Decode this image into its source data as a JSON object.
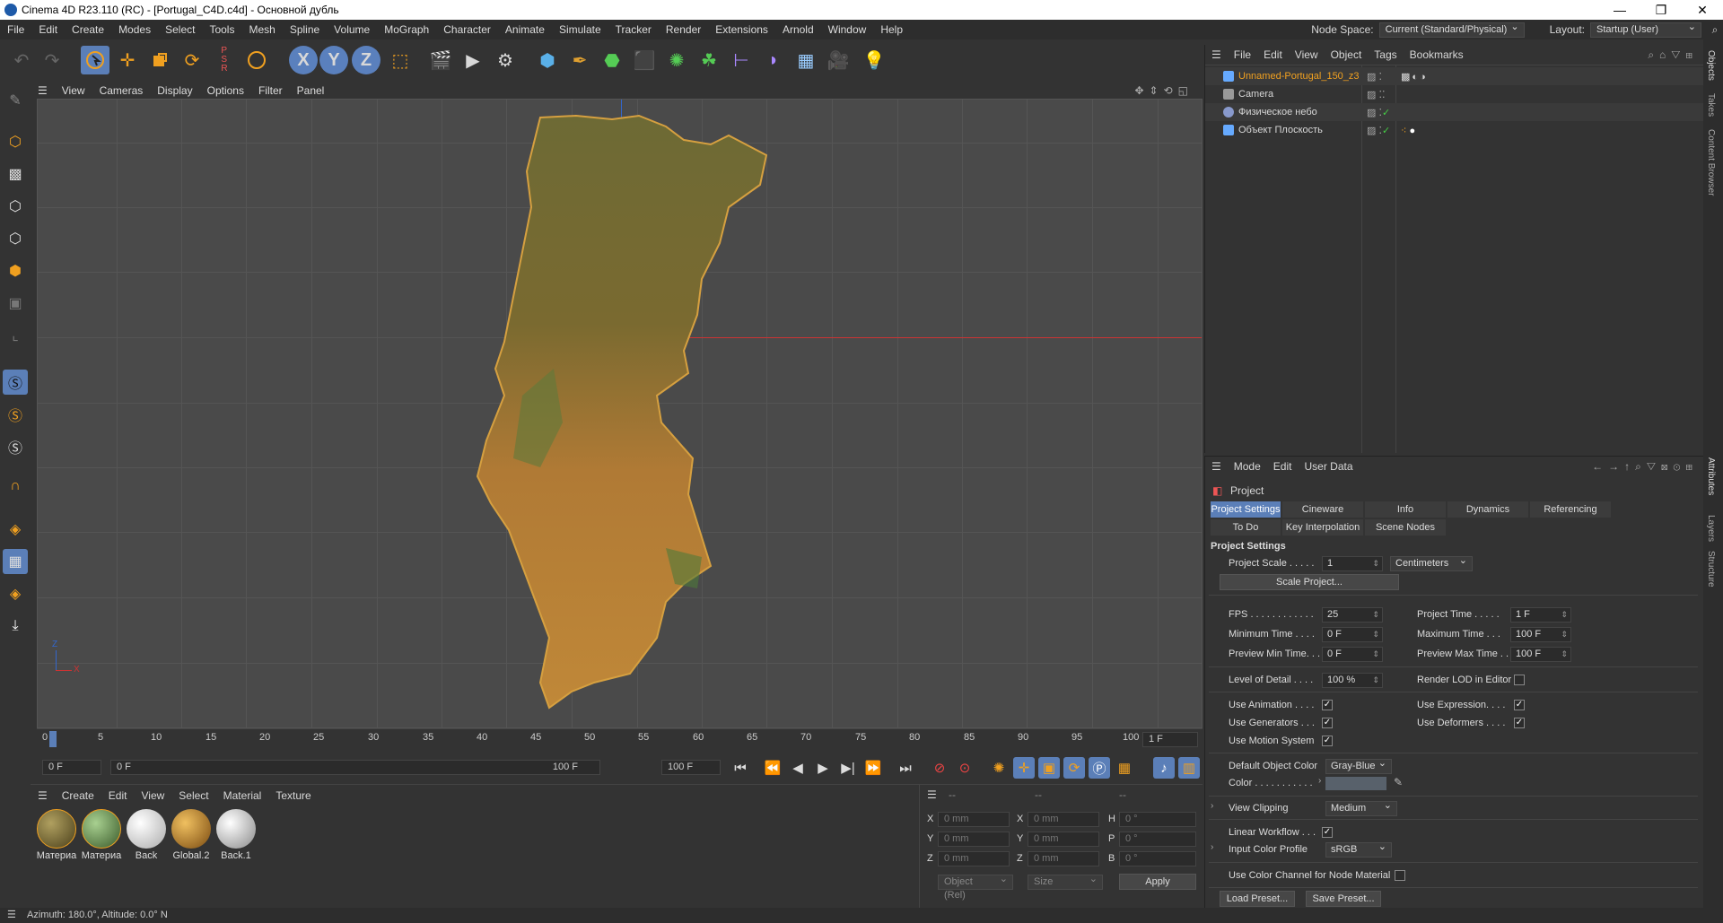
{
  "window": {
    "title": "Cinema 4D R23.110 (RC) - [Portugal_C4D.c4d] - Основной дубль",
    "controls": [
      "—",
      "❐",
      "✕"
    ]
  },
  "menubar": {
    "items": [
      "File",
      "Edit",
      "Create",
      "Modes",
      "Select",
      "Tools",
      "Mesh",
      "Spline",
      "Volume",
      "MoGraph",
      "Character",
      "Animate",
      "Simulate",
      "Tracker",
      "Render",
      "Extensions",
      "Arnold",
      "Window",
      "Help"
    ],
    "node_space_label": "Node Space:",
    "node_space_value": "Current (Standard/Physical)",
    "layout_label": "Layout:",
    "layout_value": "Startup (User)"
  },
  "viewport": {
    "menu": [
      "View",
      "Cameras",
      "Display",
      "Options",
      "Filter",
      "Panel"
    ],
    "axis_z": "Z",
    "axis_x": "X"
  },
  "timeline": {
    "ticks": [
      "0",
      "5",
      "10",
      "15",
      "20",
      "25",
      "30",
      "35",
      "40",
      "45",
      "50",
      "55",
      "60",
      "65",
      "70",
      "75",
      "80",
      "85",
      "90",
      "95",
      "100"
    ],
    "current_frame": "1 F",
    "start_field": "0 F",
    "range_start": "0 F",
    "range_end": "100 F",
    "end_field": "100 F"
  },
  "material_manager": {
    "menu": [
      "Create",
      "Edit",
      "View",
      "Select",
      "Material",
      "Texture"
    ],
    "materials": [
      {
        "name": "Материа",
        "color": "#6b5a2a"
      },
      {
        "name": "Материа",
        "color": "#5c8a4a"
      },
      {
        "name": "Back",
        "color": "#e8e8e8"
      },
      {
        "name": "Global.2",
        "color": "#c48a2a"
      },
      {
        "name": "Back.1",
        "color": "#d0d0d0"
      }
    ]
  },
  "coordinates": {
    "headers": [
      "--",
      "--",
      "--"
    ],
    "rows": [
      {
        "a": "X",
        "av": "0 mm",
        "b": "X",
        "bv": "0 mm",
        "c": "H",
        "cv": "0 °"
      },
      {
        "a": "Y",
        "av": "0 mm",
        "b": "Y",
        "bv": "0 mm",
        "c": "P",
        "cv": "0 °"
      },
      {
        "a": "Z",
        "av": "0 mm",
        "b": "Z",
        "bv": "0 mm",
        "c": "B",
        "cv": "0 °"
      }
    ],
    "mode": "Object (Rel)",
    "size": "Size",
    "apply": "Apply"
  },
  "status": {
    "text": "Azimuth: 180.0°, Altitude: 0.0°  N"
  },
  "object_manager": {
    "menu": [
      "File",
      "Edit",
      "View",
      "Object",
      "Tags",
      "Bookmarks"
    ],
    "objects": [
      {
        "name": "Unnamed-Portugal_150_z3",
        "color": "#f0a020"
      },
      {
        "name": "Camera",
        "color": "#ddd"
      },
      {
        "name": "Физическое небо",
        "color": "#ddd"
      },
      {
        "name": "Объект Плоскость",
        "color": "#ddd"
      }
    ]
  },
  "attribute_manager": {
    "menu": [
      "Mode",
      "Edit",
      "User Data"
    ],
    "object_title": "Project",
    "tabs_row1": [
      "Project Settings",
      "Cineware",
      "Info",
      "Dynamics",
      "Referencing"
    ],
    "tabs_row2": [
      "To Do",
      "Key Interpolation",
      "Scene Nodes"
    ],
    "section_title": "Project Settings",
    "project_scale_label": "Project Scale . . . . .",
    "project_scale_value": "1",
    "project_scale_unit": "Centimeters",
    "scale_project_btn": "Scale Project...",
    "fps_label": "FPS . . . . . . . . . . . .",
    "fps_value": "25",
    "project_time_label": "Project Time . . . . .",
    "project_time_value": "1 F",
    "min_time_label": "Minimum Time . . . .",
    "min_time_value": "0 F",
    "max_time_label": "Maximum Time . . .",
    "max_time_value": "100 F",
    "prev_min_label": "Preview Min Time. . .",
    "prev_min_value": "0 F",
    "prev_max_label": "Preview Max Time . .",
    "prev_max_value": "100 F",
    "lod_label": "Level of Detail . . . .",
    "lod_value": "100 %",
    "render_lod_label": "Render LOD in Editor",
    "use_animation_label": "Use Animation . . . .",
    "use_expression_label": "Use Expression. . . .",
    "use_generators_label": "Use Generators . . .",
    "use_deformers_label": "Use Deformers . . . .",
    "use_motion_label": "Use Motion System",
    "default_color_label": "Default Object Color",
    "default_color_value": "Gray-Blue",
    "color_label": "Color . . . . . . . . . . .",
    "view_clipping_label": "View Clipping",
    "view_clipping_value": "Medium",
    "linear_workflow_label": "Linear Workflow . . .",
    "input_profile_label": "Input Color Profile",
    "input_profile_value": "sRGB",
    "node_material_label": "Use Color Channel for Node Material",
    "load_preset": "Load Preset...",
    "save_preset": "Save Preset..."
  },
  "side_tabs": [
    "Objects",
    "Takes",
    "Content Browser",
    "Attributes",
    "Layers",
    "Structure"
  ]
}
